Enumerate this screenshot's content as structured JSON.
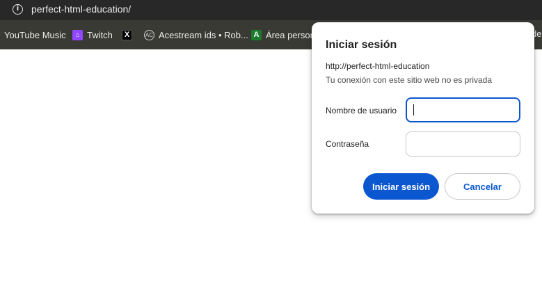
{
  "address_bar": {
    "url": "perfect-html-education/",
    "info_icon": "info-icon"
  },
  "bookmarks": [
    {
      "label": "YouTube Music",
      "icon": ""
    },
    {
      "label": "Twitch",
      "icon": "twitch-icon"
    },
    {
      "label": "",
      "icon": "x-icon"
    },
    {
      "label": "Acestream ids • Rob...",
      "icon": "acestream-icon"
    },
    {
      "label": "Área person",
      "icon": "area-icon"
    }
  ],
  "bookmarks_overflow": "de",
  "dialog": {
    "title": "Iniciar sesión",
    "origin": "http://perfect-html-education",
    "warning": "Tu conexión con este sitio web no es privada",
    "username_label": "Nombre de usuario",
    "username_value": "",
    "password_label": "Contraseña",
    "password_value": "",
    "submit_label": "Iniciar sesión",
    "cancel_label": "Cancelar"
  },
  "colors": {
    "accent": "#0b57d0",
    "toolbar": "#282828",
    "bookmarks_bar": "#3a3a35"
  }
}
